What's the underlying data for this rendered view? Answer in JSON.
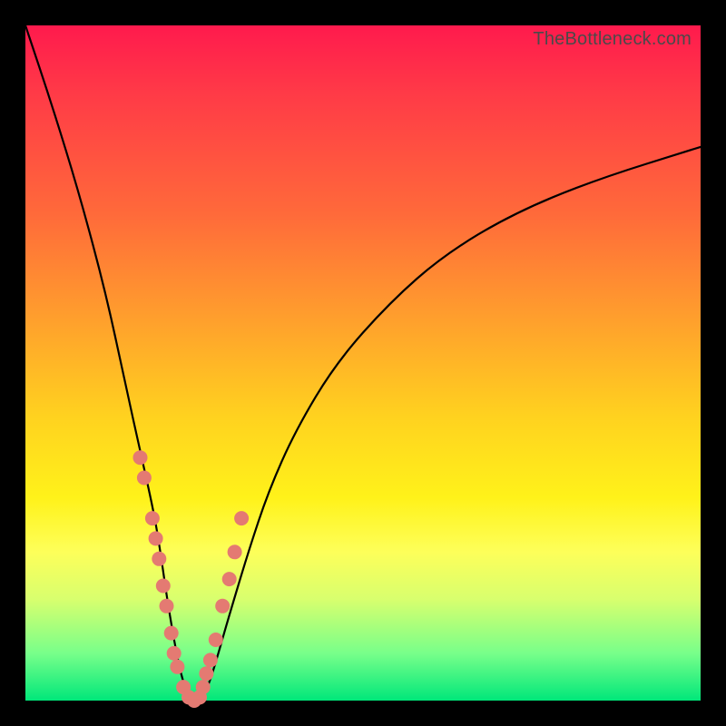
{
  "watermark": "TheBottleneck.com",
  "colors": {
    "frame": "#000000",
    "gradient_top": "#ff1a4d",
    "gradient_mid1": "#ff9a2e",
    "gradient_mid2": "#fff21a",
    "gradient_bottom": "#00e77a",
    "curve": "#000000",
    "dots": "#e47a72"
  },
  "chart_data": {
    "type": "line",
    "title": "",
    "xlabel": "",
    "ylabel": "",
    "xlim": [
      0,
      100
    ],
    "ylim": [
      0,
      100
    ],
    "series": [
      {
        "name": "bottleneck-curve",
        "x": [
          0,
          4,
          8,
          12,
          15,
          17,
          19,
          20,
          21,
          22,
          23,
          24,
          25,
          26,
          27,
          28,
          30,
          33,
          36,
          40,
          46,
          54,
          62,
          72,
          84,
          100
        ],
        "y": [
          100,
          88,
          75,
          60,
          46,
          37,
          28,
          22,
          15,
          9,
          4,
          1,
          0,
          0.5,
          2,
          5,
          12,
          22,
          31,
          40,
          50,
          59,
          66,
          72,
          77,
          82
        ]
      }
    ],
    "scatter": {
      "name": "sample-points",
      "x": [
        17.0,
        17.6,
        18.8,
        19.3,
        19.8,
        20.4,
        20.9,
        21.6,
        22.0,
        22.5,
        23.4,
        24.2,
        25.0,
        25.8,
        26.3,
        26.8,
        27.4,
        28.2,
        29.2,
        30.2,
        31.0,
        32.0
      ],
      "y": [
        36,
        33,
        27,
        24,
        21,
        17,
        14,
        10,
        7,
        5,
        2,
        0.5,
        0,
        0.5,
        2,
        4,
        6,
        9,
        14,
        18,
        22,
        27
      ]
    },
    "minimum_x": 25,
    "annotations": []
  }
}
